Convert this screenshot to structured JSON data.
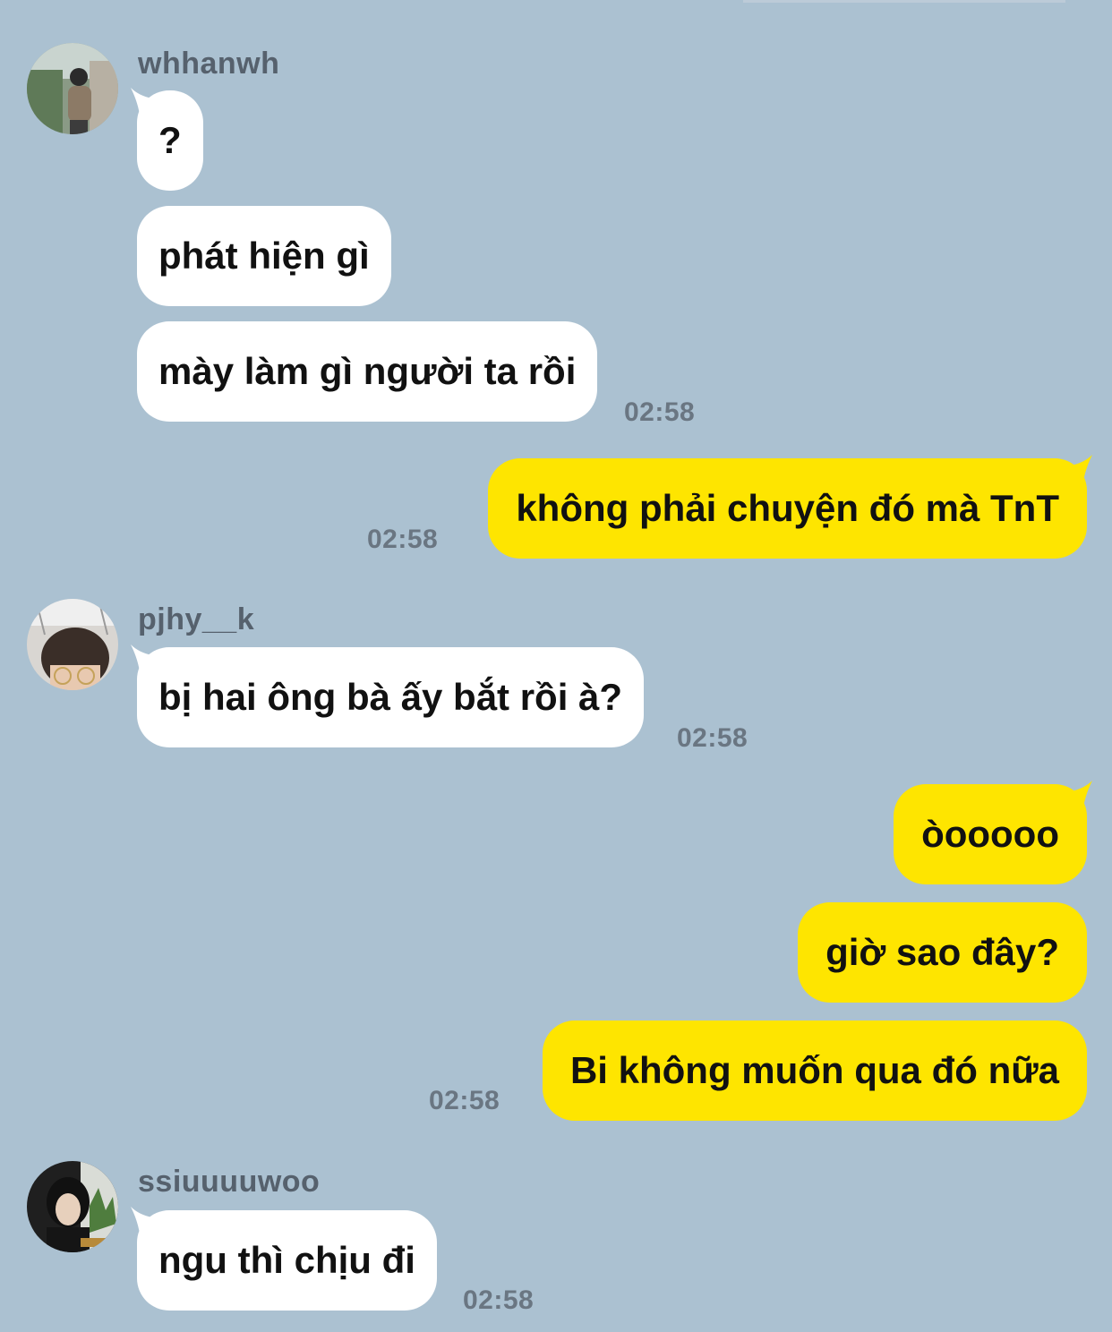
{
  "colors": {
    "background": "#abc1d1",
    "incoming_bubble": "#ffffff",
    "outgoing_bubble": "#fee500",
    "sender_name": "#56616d",
    "timestamp": "#6a7682"
  },
  "messages": [
    {
      "type": "in",
      "avatar": "whhanwh-avatar",
      "sender": "whhanwh",
      "text": "?"
    },
    {
      "type": "in",
      "text": "phát hiện gì"
    },
    {
      "type": "in",
      "text": "mày làm gì người ta rồi",
      "time": "02:58"
    },
    {
      "type": "out",
      "text": "không phải chuyện đó mà TnT",
      "time": "02:58"
    },
    {
      "type": "in",
      "avatar": "pjhy-avatar",
      "sender": "pjhy__k",
      "text": "bị hai ông bà ấy bắt rồi à?",
      "time": "02:58"
    },
    {
      "type": "out",
      "text": "òooooo"
    },
    {
      "type": "out",
      "text": "giờ sao đây?"
    },
    {
      "type": "out",
      "text": "Bi không muốn qua đó nữa",
      "time": "02:58"
    },
    {
      "type": "in",
      "avatar": "ssiuuuuwoo-avatar",
      "sender": "ssiuuuuwoo",
      "text": "ngu thì chịu đi",
      "time": "02:58"
    }
  ]
}
